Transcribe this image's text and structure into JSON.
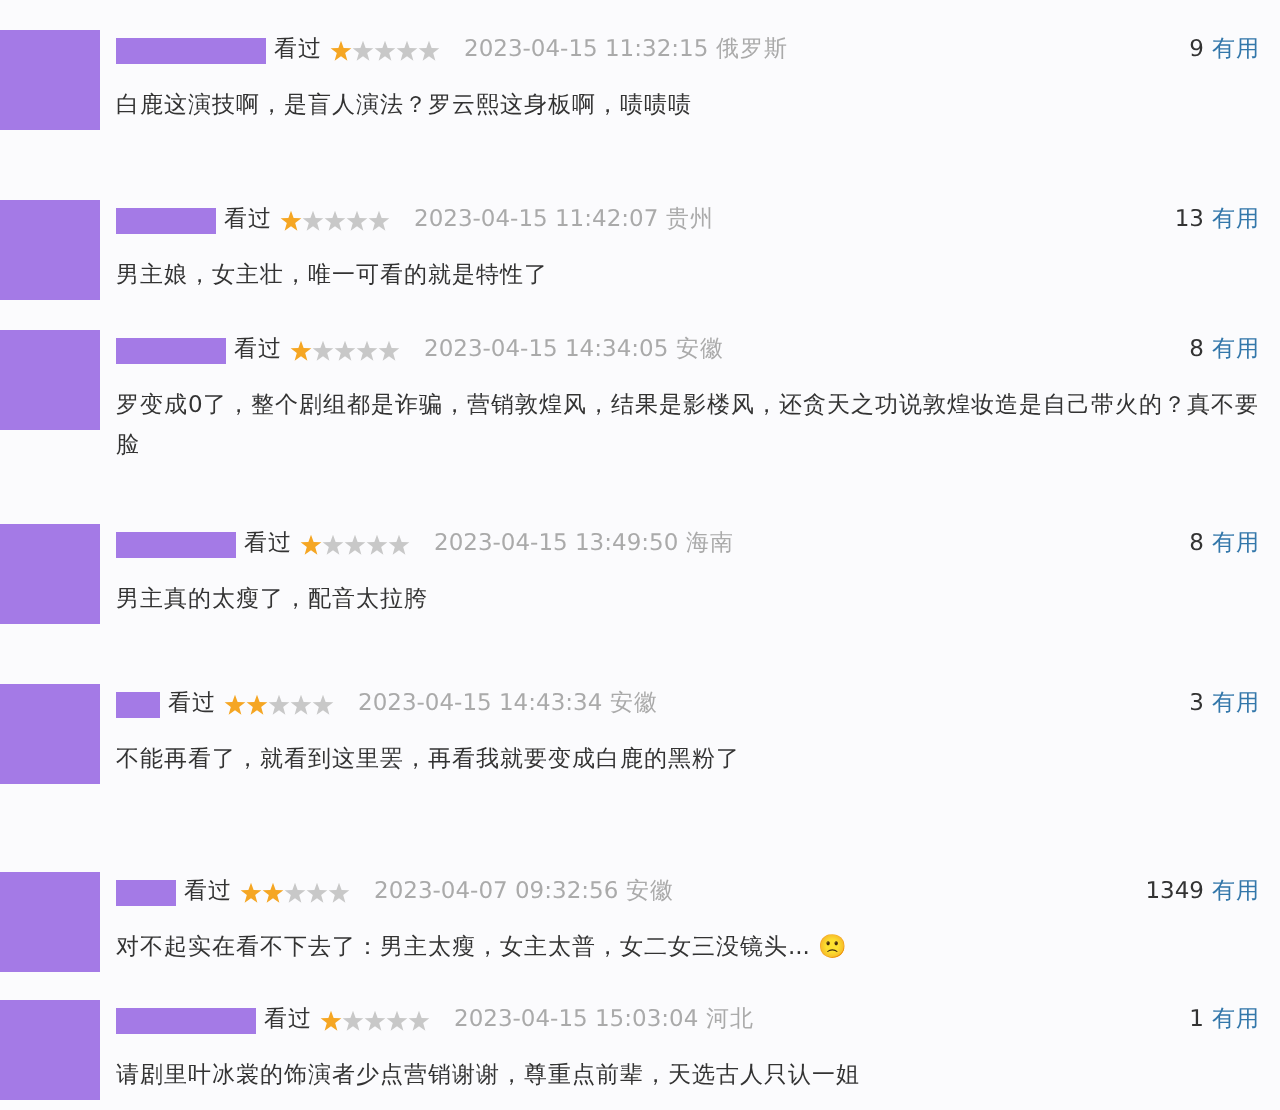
{
  "comments": [
    {
      "status": "看过",
      "stars": 1,
      "time": "2023-04-15 11:32:15",
      "location": "俄罗斯",
      "votes": "9",
      "vote_label": "有用",
      "text": "白鹿这演技啊，是盲人演法？罗云熙这身板啊，啧啧啧"
    },
    {
      "status": "看过",
      "stars": 1,
      "time": "2023-04-15 11:42:07",
      "location": "贵州",
      "votes": "13",
      "vote_label": "有用",
      "text": "男主娘，女主壮，唯一可看的就是特性了"
    },
    {
      "status": "看过",
      "stars": 1,
      "time": "2023-04-15 14:34:05",
      "location": "安徽",
      "votes": "8",
      "vote_label": "有用",
      "text": "罗变成0了，整个剧组都是诈骗，营销敦煌风，结果是影楼风，还贪天之功说敦煌妆造是自己带火的？真不要脸"
    },
    {
      "status": "看过",
      "stars": 1,
      "time": "2023-04-15 13:49:50",
      "location": "海南",
      "votes": "8",
      "vote_label": "有用",
      "text": "男主真的太瘦了，配音太拉胯"
    },
    {
      "status": "看过",
      "stars": 2,
      "time": "2023-04-15 14:43:34",
      "location": "安徽",
      "votes": "3",
      "vote_label": "有用",
      "text": "不能再看了，就看到这里罢，再看我就要变成白鹿的黑粉了"
    },
    {
      "status": "看过",
      "stars": 2,
      "time": "2023-04-07 09:32:56",
      "location": "安徽",
      "votes": "1349",
      "vote_label": "有用",
      "text": "对不起实在看不下去了：男主太瘦，女主太普，女二女三没镜头...",
      "emoji": "🙁"
    },
    {
      "status": "看过",
      "stars": 1,
      "time": "2023-04-15 15:03:04",
      "location": "河北",
      "votes": "1",
      "vote_label": "有用",
      "text": "请剧里叶冰裳的饰演者少点营销谢谢，尊重点前辈，天选古人只认一姐"
    }
  ]
}
